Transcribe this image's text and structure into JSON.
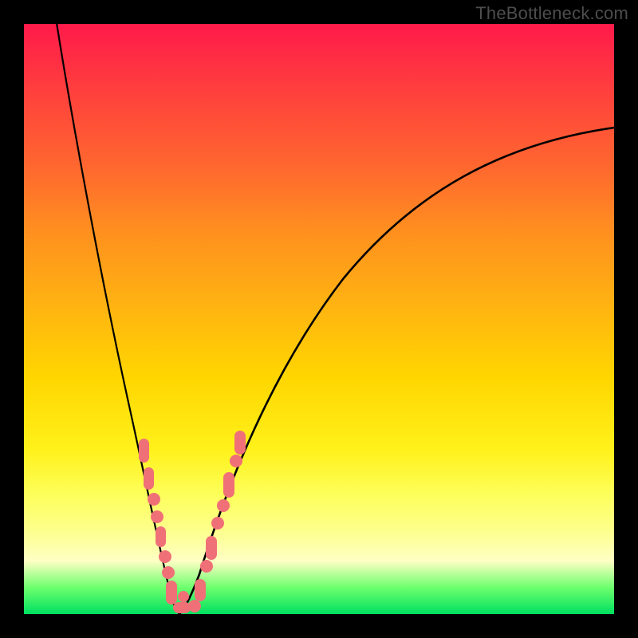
{
  "watermark": "TheBottleneck.com",
  "colors": {
    "frame": "#000000",
    "gradient_top": "#ff1a4a",
    "gradient_mid": "#ffd600",
    "gradient_bottom": "#00e060",
    "curve": "#000000",
    "beads": "#f07078"
  },
  "chart_data": {
    "type": "line",
    "title": "",
    "xlabel": "",
    "ylabel": "",
    "xlim": [
      0,
      100
    ],
    "ylim": [
      0,
      100
    ],
    "series": [
      {
        "name": "left-curve",
        "x": [
          5,
          8,
          11,
          14,
          17,
          20,
          22,
          23.5,
          25,
          26
        ],
        "y": [
          102,
          88,
          72,
          56,
          40,
          24,
          12,
          5,
          1.5,
          0
        ]
      },
      {
        "name": "right-curve",
        "x": [
          26,
          28,
          31,
          36,
          42,
          50,
          60,
          72,
          86,
          100
        ],
        "y": [
          0,
          3,
          10,
          22,
          35,
          48,
          59,
          68,
          76,
          82
        ]
      }
    ],
    "annotations": [
      {
        "name": "beads-left",
        "on_series": "left-curve",
        "y_range": [
          0,
          30
        ]
      },
      {
        "name": "beads-right",
        "on_series": "right-curve",
        "y_range": [
          0,
          30
        ]
      }
    ]
  }
}
